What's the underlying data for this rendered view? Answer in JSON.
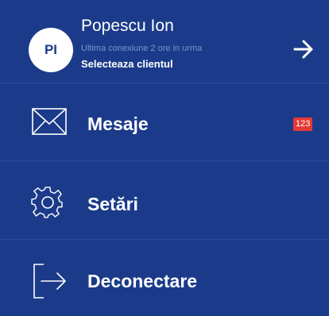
{
  "profile": {
    "initials": "PI",
    "name": "Popescu Ion",
    "last_login": "Ultima conexiune 2 ore in urma",
    "select_client": "Selecteaza clientul",
    "arrow_icon": "arrow-right-icon"
  },
  "menu": {
    "messages": {
      "label": "Mesaje",
      "icon": "envelope-icon",
      "badge": "123"
    },
    "settings": {
      "label": "Setări",
      "icon": "gear-icon"
    },
    "logout": {
      "label": "Deconectare",
      "icon": "logout-icon"
    }
  },
  "colors": {
    "background": "#1b3b8a",
    "text": "#ffffff",
    "subtext": "#7c93c9",
    "badge": "#e53935"
  }
}
